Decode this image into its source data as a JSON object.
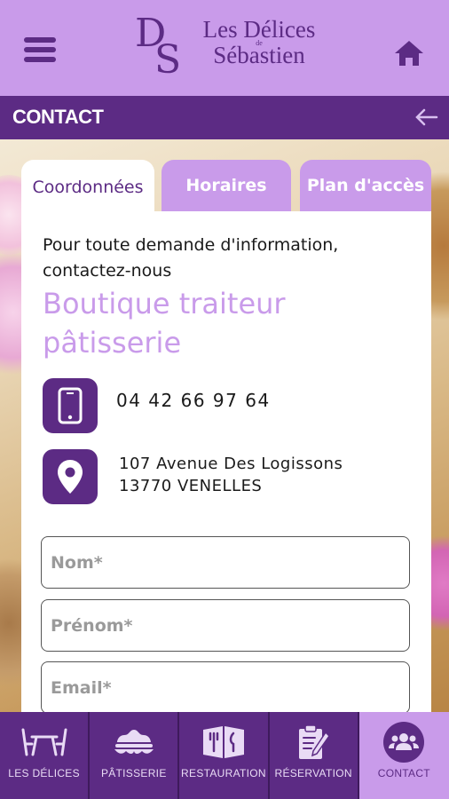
{
  "header": {
    "logo_initials_d": "D",
    "logo_initials_s": "S",
    "logo_line1": "Les Délices",
    "logo_line2": "de",
    "logo_line3": "Sébastien",
    "menu_icon": "hamburger-menu-icon",
    "home_icon": "home-icon"
  },
  "titlebar": {
    "title": "CONTACT",
    "back_icon": "arrow-left-icon"
  },
  "tabs": [
    {
      "label": "Coordonnées",
      "active": true
    },
    {
      "label": "Horaires",
      "active": false
    },
    {
      "label": "Plan d'accès",
      "active": false
    }
  ],
  "contact": {
    "intro": "Pour toute demande d'information, contactez-nous",
    "shop_name": "Boutique traiteur pâtisserie",
    "phone": "04 42 66 97 64",
    "address_line1": "107 Avenue Des Logissons",
    "address_line2": "13770 VENELLES"
  },
  "form": {
    "name_placeholder": "Nom*",
    "firstname_placeholder": "Prénom*",
    "email_placeholder": "Email*"
  },
  "bottom_nav": [
    {
      "label": "LES DÉLICES",
      "icon": "tables-chairs-icon",
      "active": false
    },
    {
      "label": "PÂTISSERIE",
      "icon": "cake-icon",
      "active": false
    },
    {
      "label": "RESTAURATION",
      "icon": "menu-cutlery-icon",
      "active": false
    },
    {
      "label": "RÉSERVATION",
      "icon": "clipboard-pen-icon",
      "active": false
    },
    {
      "label": "CONTACT",
      "icon": "people-icon",
      "active": true
    }
  ],
  "colors": {
    "primary": "#5c2b84",
    "accent": "#c99bea",
    "background": "#ffffff"
  }
}
